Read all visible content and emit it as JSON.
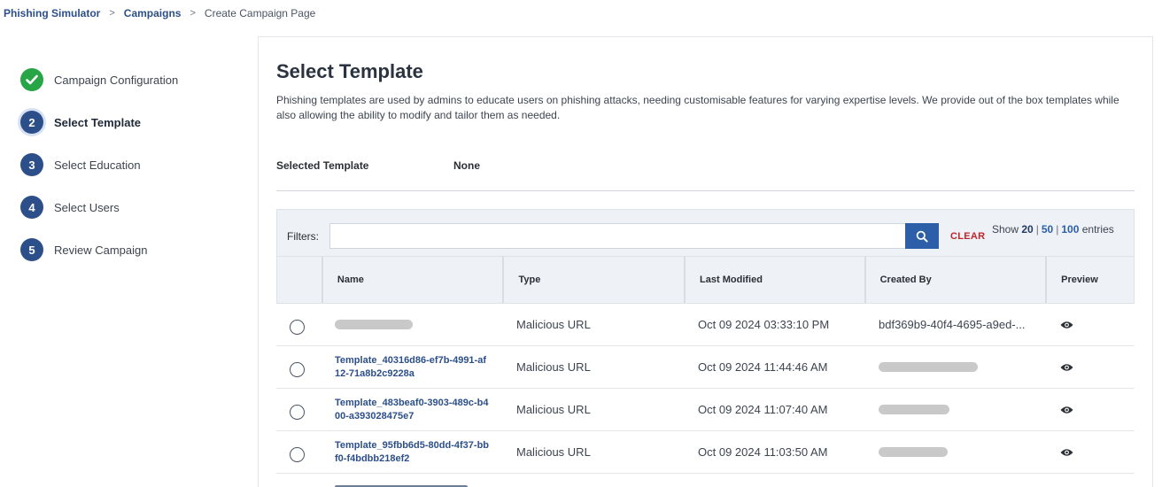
{
  "breadcrumb": {
    "items": [
      "Phishing Simulator",
      "Campaigns",
      "Create Campaign Page"
    ],
    "separator": ">"
  },
  "steps": [
    {
      "number": "",
      "label": "Campaign Configuration",
      "state": "done"
    },
    {
      "number": "2",
      "label": "Select Template",
      "state": "active"
    },
    {
      "number": "3",
      "label": "Select Education",
      "state": "pending"
    },
    {
      "number": "4",
      "label": "Select Users",
      "state": "pending"
    },
    {
      "number": "5",
      "label": "Review Campaign",
      "state": "pending"
    }
  ],
  "page": {
    "title": "Select Template",
    "description": "Phishing templates are used by admins to educate users on phishing attacks, needing customisable features for varying expertise levels. We provide out of the box templates while also allowing the ability to modify and tailor them as needed.",
    "selected_template_label": "Selected Template",
    "selected_template_value": "None"
  },
  "filters": {
    "label": "Filters:",
    "input_value": "",
    "search_icon": "search-icon",
    "clear_label": "CLEAR",
    "show_prefix": "Show",
    "options": [
      "20",
      "50",
      "100"
    ],
    "selected_option": "20",
    "show_suffix": "entries"
  },
  "table": {
    "columns": [
      "",
      "Name",
      "Type",
      "Last Modified",
      "Created By",
      "Preview"
    ],
    "rows": [
      {
        "name": "",
        "name_redacted": true,
        "type": "Malicious URL",
        "last_modified": "Oct 09 2024 03:33:10 PM",
        "created_by": "bdf369b9-40f4-4695-a9ed-...",
        "created_redacted": false
      },
      {
        "name": "Template_40316d86-ef7b-4991-af12-71a8b2c9228a",
        "name_redacted": false,
        "type": "Malicious URL",
        "last_modified": "Oct 09 2024 11:44:46 AM",
        "created_by": "",
        "created_redacted": true
      },
      {
        "name": "Template_483beaf0-3903-489c-b400-a393028475e7",
        "name_redacted": false,
        "type": "Malicious URL",
        "last_modified": "Oct 09 2024 11:07:40 AM",
        "created_by": "",
        "created_redacted": true
      },
      {
        "name": "Template_95fbb6d5-80dd-4f37-bbf0-f4bdbb218ef2",
        "name_redacted": false,
        "type": "Malicious URL",
        "last_modified": "Oct 09 2024 11:03:50 AM",
        "created_by": "",
        "created_redacted": true
      }
    ],
    "preview_icon": "eye-icon"
  },
  "colors": {
    "primary": "#2c4f8a",
    "success": "#27a547",
    "danger": "#c0252b",
    "button": "#2c5fa8"
  }
}
